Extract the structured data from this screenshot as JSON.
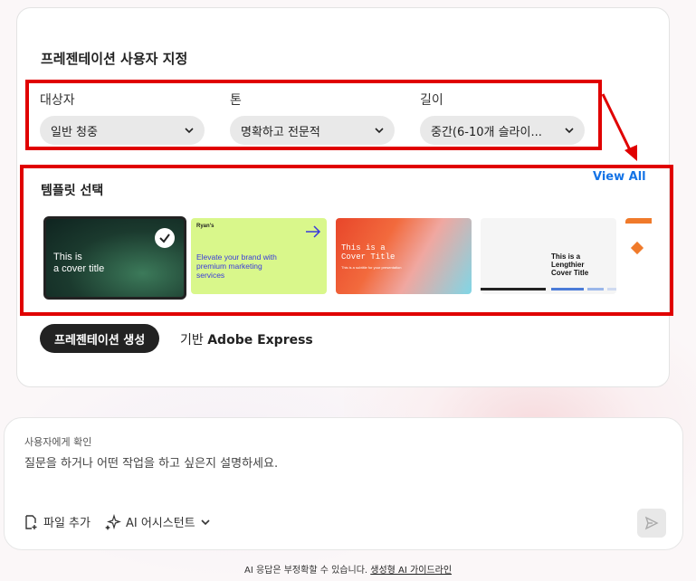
{
  "card": {
    "title": "프레젠테이션 사용자 지정",
    "options": [
      {
        "label": "대상자",
        "value": "일반 청중"
      },
      {
        "label": "톤",
        "value": "명확하고 전문적"
      },
      {
        "label": "길이",
        "value": "중간(6-10개 슬라이..."
      }
    ],
    "templates": {
      "title": "템플릿 선택",
      "view_all": "View All",
      "items": [
        {
          "text": "This is\na cover title",
          "selected": true
        },
        {
          "text": "Elevate your brand with premium marketing services",
          "brand": "Ryan's"
        },
        {
          "text": "This is a\nCover Title",
          "sub": "This is a subtitle for your presentation"
        },
        {
          "text": "This is a\nLengthier\nCover Title"
        },
        {
          "text": ""
        }
      ]
    },
    "create_button": "프레젠테이션 생성",
    "based_prefix": "기반",
    "based_brand": "Adobe Express"
  },
  "chat": {
    "hint": "사용자에게 확인",
    "placeholder": "질문을 하거나 어떤 작업을 하고 싶은지 설명하세요.",
    "tools": {
      "add_file": "파일 추가",
      "assistant": "AI 어시스턴트"
    }
  },
  "footer": {
    "text": "AI 응답은 부정확할 수 있습니다.",
    "link": "생성형 AI 가이드라인"
  },
  "colors": {
    "highlight": "#e00000",
    "link": "#1473e6"
  }
}
